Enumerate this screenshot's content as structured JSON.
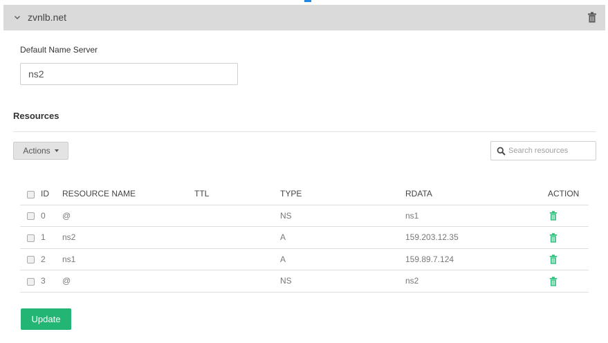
{
  "domain": {
    "name": "zvnlb.net"
  },
  "name_server": {
    "label": "Default Name Server",
    "value": "ns2"
  },
  "resources": {
    "heading": "Resources",
    "actions_label": "Actions",
    "search_placeholder": "Search resources",
    "columns": {
      "id": "ID",
      "name": "RESOURCE NAME",
      "ttl": "TTL",
      "type": "TYPE",
      "rdata": "RDATA",
      "action": "ACTION"
    },
    "rows": [
      {
        "id": "0",
        "name": "@",
        "ttl": "",
        "type": "NS",
        "rdata": "ns1"
      },
      {
        "id": "1",
        "name": "ns2",
        "ttl": "",
        "type": "A",
        "rdata": "159.203.12.35"
      },
      {
        "id": "2",
        "name": "ns1",
        "ttl": "",
        "type": "A",
        "rdata": "159.89.7.124"
      },
      {
        "id": "3",
        "name": "@",
        "ttl": "",
        "type": "NS",
        "rdata": "ns2"
      }
    ]
  },
  "footer": {
    "update_label": "Update"
  },
  "colors": {
    "accent": "#22b573",
    "bar": "#dadada",
    "marker": "#1e88e5"
  },
  "icons": {
    "collapse": "chevron-down-icon",
    "domain_delete": "trash-icon",
    "row_delete": "trash-icon",
    "search": "search-icon"
  }
}
